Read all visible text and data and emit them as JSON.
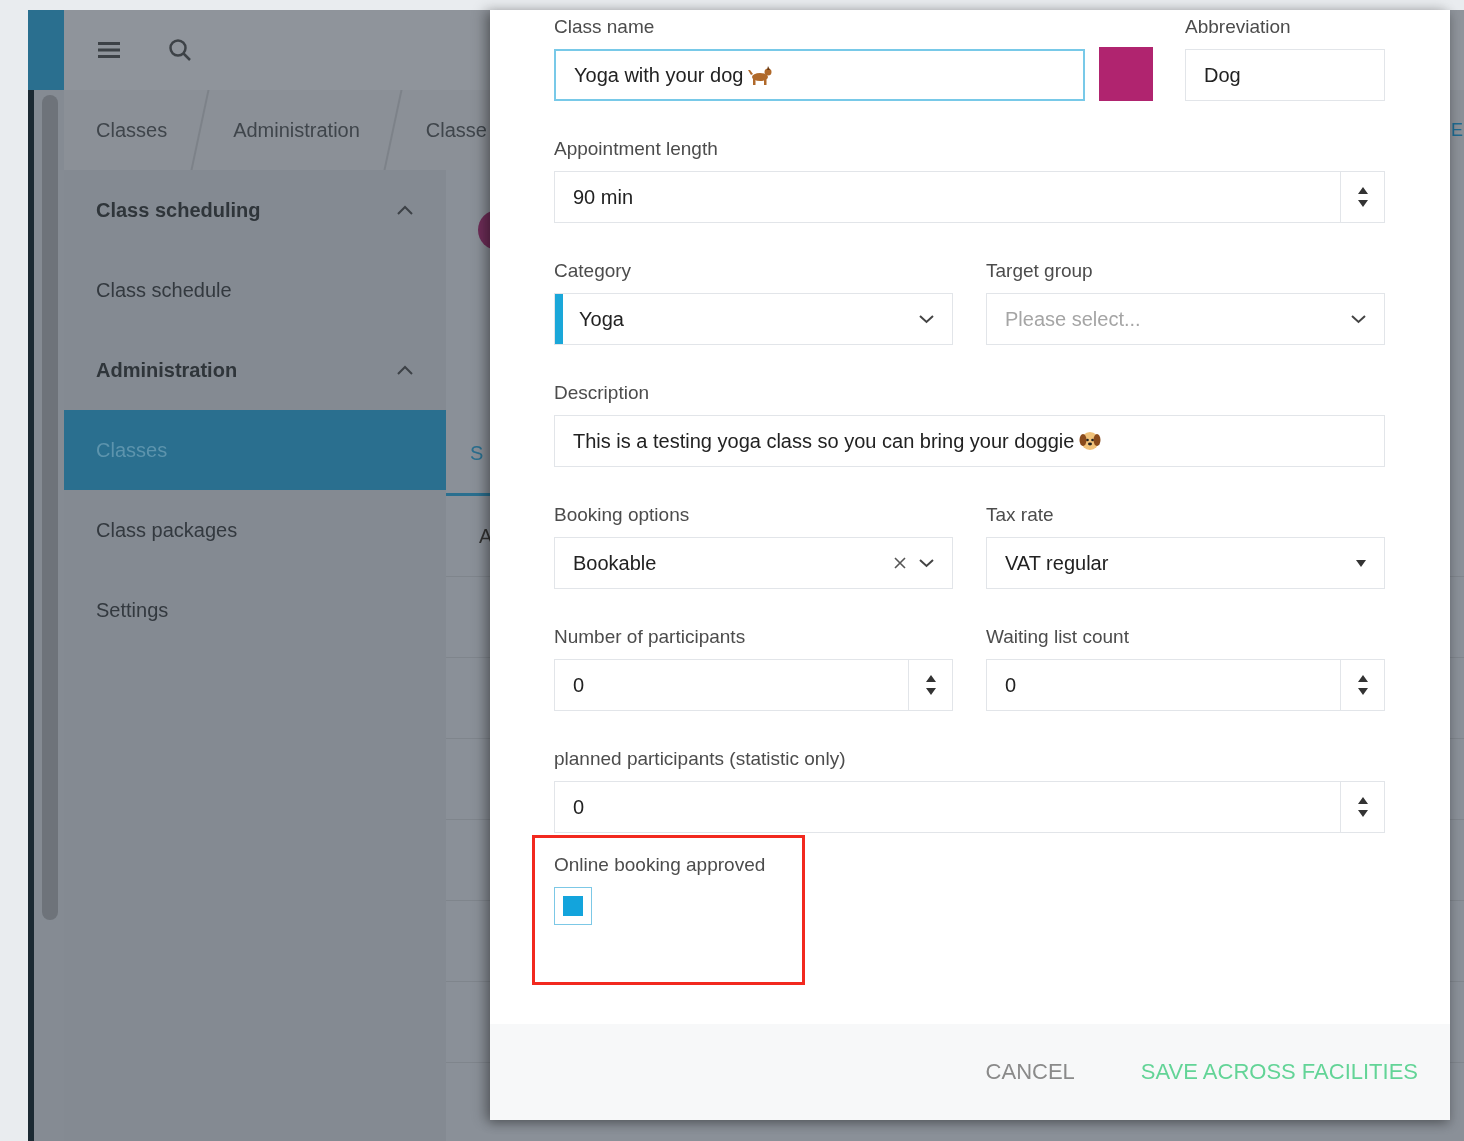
{
  "app": {
    "breadcrumbs": [
      "Classes",
      "Administration",
      "Classe"
    ],
    "sidebar": [
      {
        "label": "Class scheduling",
        "expanded": true,
        "children": [
          {
            "label": "Class schedule",
            "selected": false
          }
        ]
      },
      {
        "label": "Administration",
        "expanded": true,
        "children": [
          {
            "label": "Classes",
            "selected": true
          },
          {
            "label": "Class packages",
            "selected": false
          },
          {
            "label": "Settings",
            "selected": false
          }
        ]
      }
    ],
    "tab_fragment": "S",
    "row_fragment": "A",
    "edge_fragment": "E"
  },
  "dialog": {
    "rows": [
      [
        {
          "kind": "text",
          "label": "Class name",
          "value": "Yoga with your dog",
          "focused": true,
          "trailing_icon": true
        },
        {
          "kind": "swatch",
          "color": "#b0246f"
        },
        {
          "kind": "text",
          "label": "Abbreviation",
          "value": "Dog",
          "focused": false
        }
      ],
      [
        {
          "kind": "number",
          "label": "Appointment length",
          "value": "90 min"
        }
      ],
      [
        {
          "kind": "select",
          "label": "Category",
          "value": "Yoga",
          "color": "#1aa7d9"
        },
        {
          "kind": "select",
          "label": "Target group",
          "placeholder": "Please select..."
        }
      ],
      [
        {
          "kind": "textarea",
          "label": "Description",
          "value": "This is a testing yoga class so you can bring your doggie",
          "trailing_icon": true
        }
      ],
      [
        {
          "kind": "select",
          "label": "Booking options",
          "value": "Bookable",
          "clearable": true
        },
        {
          "kind": "native-select",
          "label": "Tax rate",
          "value": "VAT regular"
        }
      ],
      [
        {
          "kind": "number",
          "label": "Number of participants",
          "value": "0"
        },
        {
          "kind": "number",
          "label": "Waiting list count",
          "value": "0"
        }
      ],
      [
        {
          "kind": "number",
          "label": "planned participants (statistic only)",
          "value": "0"
        }
      ],
      [
        {
          "kind": "checkbox",
          "label": "Online booking approved",
          "checked": true,
          "highlighted": true
        }
      ]
    ],
    "buttons": [
      {
        "label": "CANCEL",
        "kind": "text"
      },
      {
        "label": "SAVE ACROSS FACILITIES",
        "kind": "primary"
      }
    ]
  }
}
